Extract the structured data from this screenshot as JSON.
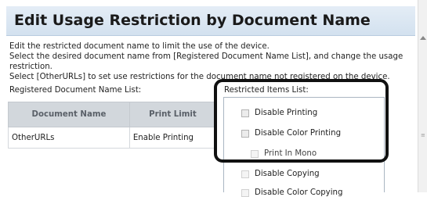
{
  "header": {
    "title": "Edit Usage Restriction by Document Name"
  },
  "description": {
    "line1": "Edit the restricted document name to limit the use of the device.",
    "line2": "Select the desired document name from [Registered Document Name List], and change the usage",
    "line3": "restriction.",
    "line4": "Select [OtherURLs] to set use restrictions for the document name not registered on the device."
  },
  "registered_list": {
    "label": "Registered Document Name List:",
    "columns": [
      "Document Name",
      "Print Limit"
    ],
    "rows": [
      {
        "name": "OtherURLs",
        "limit": "Enable Printing"
      }
    ]
  },
  "restricted_items": {
    "label": "Restricted Items List:",
    "items": [
      {
        "label": "Disable Printing",
        "checked": false
      },
      {
        "label": "Disable Color Printing",
        "checked": false
      },
      {
        "label": "Print In Mono",
        "checked": false
      },
      {
        "label": "Disable Copying",
        "checked": false
      },
      {
        "label": "Disable Color Copying",
        "checked": false
      }
    ]
  },
  "colors": {
    "title_bar": "#d9e5f1",
    "table_header": "#d2d7dc",
    "highlight_border": "#111111"
  },
  "icons": {
    "scroll_up": "triangle-up-icon",
    "scroll_grip": "grip-lines-icon"
  }
}
